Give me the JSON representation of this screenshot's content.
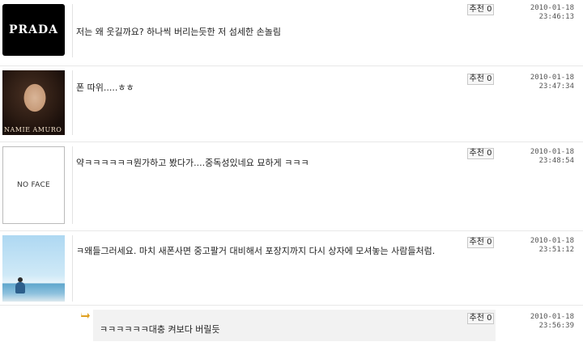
{
  "comments": [
    {
      "avatar_label": "PRADA",
      "text": "저는 왜 웃길까요? 하나씩 버리는듯한 저 섬세한 손놀림",
      "recommend": "추천 0",
      "date": "2010-01-18",
      "time": "23:46:13"
    },
    {
      "avatar_label": "NAMIE AMURO",
      "text": "폰 따위.....ㅎㅎ",
      "recommend": "추천 0",
      "date": "2010-01-18",
      "time": "23:47:34"
    },
    {
      "avatar_label": "NO FACE",
      "text": "약ㅋㅋㅋㅋㅋㅋ뭔가하고 봤다가....중독성있네요 묘하게 ㅋㅋㅋ",
      "recommend": "추천 0",
      "date": "2010-01-18",
      "time": "23:48:54"
    },
    {
      "avatar_label": "",
      "text": "ㅋ왜들그러세요. 마치 새폰사면 중고팔거 대비해서 포장지까지 다시 상자에 모셔놓는 사람들처럼.",
      "recommend": "추천 0",
      "date": "2010-01-18",
      "time": "23:51:12"
    }
  ],
  "reply": {
    "text": "ㅋㅋㅋㅋㅋㅋ대충 켜보다 버릴듯",
    "recommend": "추천 0",
    "date": "2010-01-18",
    "time": "23:56:39"
  },
  "colors": {
    "separator": "#e8e8e8",
    "reply_bg": "#f2f2f2",
    "reply_arrow": "#e0a020"
  },
  "icons": {
    "reply": "reply-arrow-icon"
  }
}
